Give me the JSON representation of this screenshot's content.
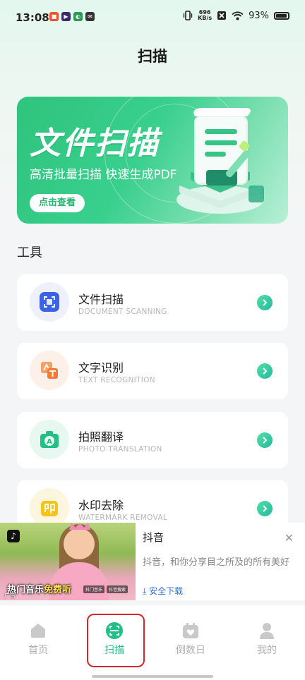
{
  "status": {
    "time": "13:08",
    "net_speed": "696",
    "net_unit": "KB/s",
    "battery": "93%"
  },
  "page": {
    "title": "扫描"
  },
  "banner": {
    "title": "文件扫描",
    "subtitle": "高清批量扫描 快速生成PDF",
    "button": "点击查看"
  },
  "tools": {
    "section_title": "工具",
    "items": [
      {
        "name": "文件扫描",
        "en": "DOCUMENT SCANNING",
        "icon": "scan-icon",
        "color": "#3b63e8"
      },
      {
        "name": "文字识别",
        "en": "TEXT RECOGNITION",
        "icon": "text-recognition-icon",
        "color": "#f47a37"
      },
      {
        "name": "拍照翻译",
        "en": "PHOTO TRANSLATION",
        "icon": "camera-translate-icon",
        "color": "#22c087"
      },
      {
        "name": "水印去除",
        "en": "WATERMARK REMOVAL",
        "icon": "stamp-icon",
        "color": "#f6c21c"
      }
    ]
  },
  "ad": {
    "caption_white": "热门音乐",
    "caption_yellow": "免费听",
    "badge_left": "抖门音乐",
    "badge_right": "抖音搜索",
    "small": "广告",
    "title": "抖音",
    "description": "抖音，和你分享目之所及的所有美好",
    "download": "安全下载"
  },
  "nav": {
    "items": [
      {
        "label": "首页",
        "icon": "home-icon"
      },
      {
        "label": "扫描",
        "icon": "scan-tab-icon",
        "active": true
      },
      {
        "label": "倒数日",
        "icon": "calendar-heart-icon"
      },
      {
        "label": "我的",
        "icon": "profile-icon"
      }
    ]
  },
  "colors": {
    "accent": "#22c087",
    "highlight_outline": "#d4262e"
  }
}
